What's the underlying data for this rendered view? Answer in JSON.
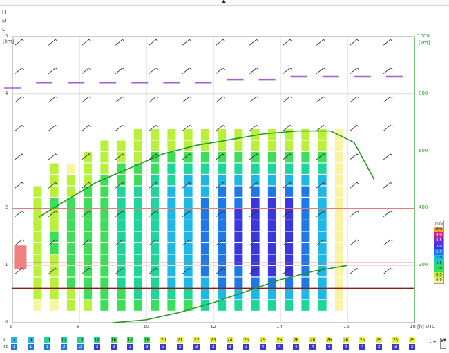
{
  "cloud_layers": [
    "H",
    "M",
    "L"
  ],
  "left_axis": {
    "unit": "[km]",
    "ticks": [
      "5",
      "4",
      "2",
      "1",
      "0"
    ]
  },
  "right_axis": {
    "unit": "[km]",
    "ticks": [
      "1000",
      "800",
      "600",
      "400",
      "200"
    ]
  },
  "x_axis": {
    "ticks": [
      "6",
      "8",
      "10",
      "12",
      "14",
      "16",
      "18"
    ],
    "unit": "[h] UTC"
  },
  "legend": {
    "unit": "m/s",
    "entries": [
      {
        "label": "dyn",
        "color": "#e8a33a"
      },
      {
        "label": "4.0",
        "color": "#cc1e8e"
      },
      {
        "label": "3.5",
        "color": "#6a2bd8"
      },
      {
        "label": "3.0",
        "color": "#3a38dd"
      },
      {
        "label": "2.5",
        "color": "#1e78e6"
      },
      {
        "label": "2.0",
        "color": "#1eb8e6"
      },
      {
        "label": "1.5",
        "color": "#1ed69a"
      },
      {
        "label": "1.0",
        "color": "#3ede5a"
      },
      {
        "label": "0.5",
        "color": "#b8f03a"
      },
      {
        "label": "0.0",
        "color": "#f8f4a0"
      }
    ]
  },
  "thermal_strength": [
    [
      0.3,
      0.5,
      0.5,
      0.8,
      0.8,
      0.8,
      0.8,
      0.8,
      0.8,
      0.8,
      0.5
    ],
    [
      0.3,
      0.5,
      0.8,
      0.8,
      0.8,
      1.2,
      1.2,
      0.8,
      0.8,
      1.2,
      0.8,
      0.5,
      0.5
    ],
    [
      0.8,
      0.8,
      1.2,
      1.2,
      1.2,
      1.2,
      1.2,
      1.2,
      1.2,
      1.2,
      0.8,
      0.5,
      0.3
    ],
    [
      0.8,
      1.2,
      1.2,
      1.2,
      1.2,
      1.2,
      1.2,
      1.2,
      1.2,
      1.2,
      1.2,
      0.8,
      0.8,
      0.5
    ],
    [
      1.2,
      1.2,
      1.2,
      1.2,
      1.2,
      1.2,
      1.2,
      1.2,
      1.2,
      1.2,
      1.2,
      1.2,
      0.8,
      0.8,
      0.5
    ],
    [
      1.2,
      1.2,
      1.7,
      1.7,
      1.7,
      1.7,
      1.7,
      1.7,
      1.7,
      1.7,
      1.7,
      1.2,
      1.2,
      0.8,
      0.5
    ],
    [
      1.2,
      1.7,
      1.7,
      1.7,
      1.7,
      1.7,
      1.7,
      1.7,
      1.7,
      1.7,
      1.7,
      1.2,
      1.2,
      0.8,
      0.8,
      0.5
    ],
    [
      1.2,
      1.7,
      1.7,
      1.7,
      1.7,
      1.7,
      1.7,
      1.7,
      1.7,
      1.7,
      1.7,
      1.7,
      1.2,
      1.2,
      0.8,
      0.5
    ],
    [
      1.2,
      1.7,
      2.2,
      2.2,
      2.2,
      2.2,
      2.2,
      2.2,
      2.2,
      2.2,
      2.2,
      1.7,
      1.7,
      1.2,
      0.8,
      0.5
    ],
    [
      1.2,
      1.7,
      2.2,
      2.2,
      2.2,
      2.2,
      2.2,
      2.2,
      2.2,
      2.2,
      2.2,
      2.2,
      1.7,
      1.2,
      0.8,
      0.5
    ],
    [
      1.7,
      2.2,
      2.2,
      2.7,
      2.7,
      2.7,
      2.7,
      2.7,
      2.7,
      2.7,
      2.2,
      2.2,
      1.7,
      1.2,
      0.8,
      0.5
    ],
    [
      1.7,
      2.2,
      2.7,
      2.7,
      2.7,
      2.7,
      2.7,
      2.7,
      2.7,
      2.7,
      2.7,
      2.2,
      1.7,
      1.2,
      0.8,
      0.5
    ],
    [
      1.7,
      2.2,
      2.7,
      2.7,
      3.2,
      3.2,
      3.2,
      3.2,
      3.2,
      2.7,
      2.7,
      2.2,
      1.7,
      1.2,
      0.8,
      0.5
    ],
    [
      1.7,
      2.2,
      2.7,
      3.2,
      3.2,
      3.2,
      3.2,
      3.2,
      3.2,
      3.2,
      2.7,
      2.2,
      1.7,
      1.2,
      0.8,
      0.5
    ],
    [
      1.7,
      2.2,
      2.7,
      3.2,
      3.2,
      3.2,
      3.2,
      3.2,
      3.2,
      3.2,
      2.7,
      2.2,
      1.7,
      1.2,
      0.8,
      0.5
    ],
    [
      1.7,
      2.2,
      2.7,
      3.2,
      3.2,
      3.2,
      3.2,
      3.2,
      3.2,
      3.2,
      2.7,
      2.2,
      1.7,
      1.2,
      0.8,
      0.5
    ],
    [
      1.7,
      2.2,
      2.7,
      2.7,
      2.7,
      2.7,
      2.7,
      2.7,
      2.7,
      2.7,
      2.7,
      2.2,
      1.7,
      1.2,
      0.8,
      0.5
    ],
    [
      1.7,
      2.2,
      2.2,
      2.2,
      2.2,
      2.2,
      2.2,
      2.2,
      2.2,
      2.2,
      2.2,
      2.2,
      1.7,
      1.2,
      0.8,
      0.5
    ],
    [
      0.3,
      0.3,
      0.3,
      0.3,
      0.3,
      0.3,
      0.3,
      0.3,
      0.3,
      0.3,
      0.3,
      0.3,
      0.3,
      0.3,
      0.3,
      0.3
    ]
  ],
  "temperature_row": {
    "label": "T",
    "values": [
      "7",
      "9",
      "10",
      "12",
      "13",
      "14",
      "16",
      "17",
      "18",
      "20",
      "21",
      "22",
      "23",
      "24",
      "25",
      "25",
      "26",
      "26",
      "26",
      "26",
      "26",
      "25",
      "25",
      "25",
      "25"
    ]
  },
  "dewpoint_row": {
    "label": "Td",
    "values": [
      "1",
      "1",
      "1",
      "2",
      "2",
      "3",
      "3",
      "3",
      "3",
      "3",
      "3",
      "3",
      "3",
      "3",
      "3",
      "4",
      "4",
      "4",
      "4",
      "4",
      "4",
      "4",
      "3",
      "3",
      "3"
    ]
  },
  "zoom_control": "-|+",
  "scroll_control": "▲▼"
}
